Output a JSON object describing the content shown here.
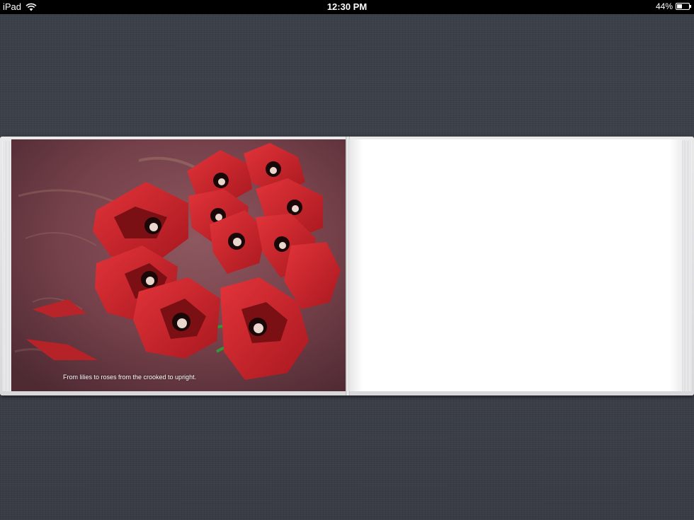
{
  "status_bar": {
    "device": "iPad",
    "time": "12:30 PM",
    "battery_percent": "44%",
    "battery_level": 0.44,
    "wifi_icon": "wifi-icon",
    "battery_icon": "battery-icon"
  },
  "book": {
    "left_page": {
      "illustration": "red origami poppies on mauve background",
      "caption": "From lilies to roses from the crooked to upright."
    },
    "right_page": {
      "content": ""
    }
  },
  "colors": {
    "background": "#3a3e46",
    "poppy_red": "#c8262b",
    "page_background": "#7b4550"
  }
}
